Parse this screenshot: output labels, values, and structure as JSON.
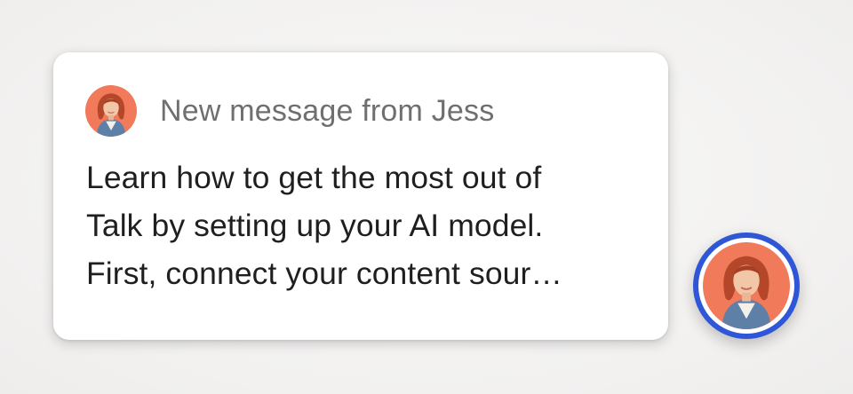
{
  "notification": {
    "sender_line": "New message from Jess",
    "message_lines": [
      "Learn how to get the most out of",
      "Talk by setting up your AI model.",
      "First, connect your content sour…"
    ],
    "avatar_icon": "agent-avatar-photo"
  },
  "launcher": {
    "icon": "agent-avatar-photo",
    "ring_color": "#2f56d6"
  },
  "colors": {
    "avatar_background": "#f07a5a",
    "sender_text": "#6f6f6f",
    "message_text": "#1f1f1f"
  }
}
